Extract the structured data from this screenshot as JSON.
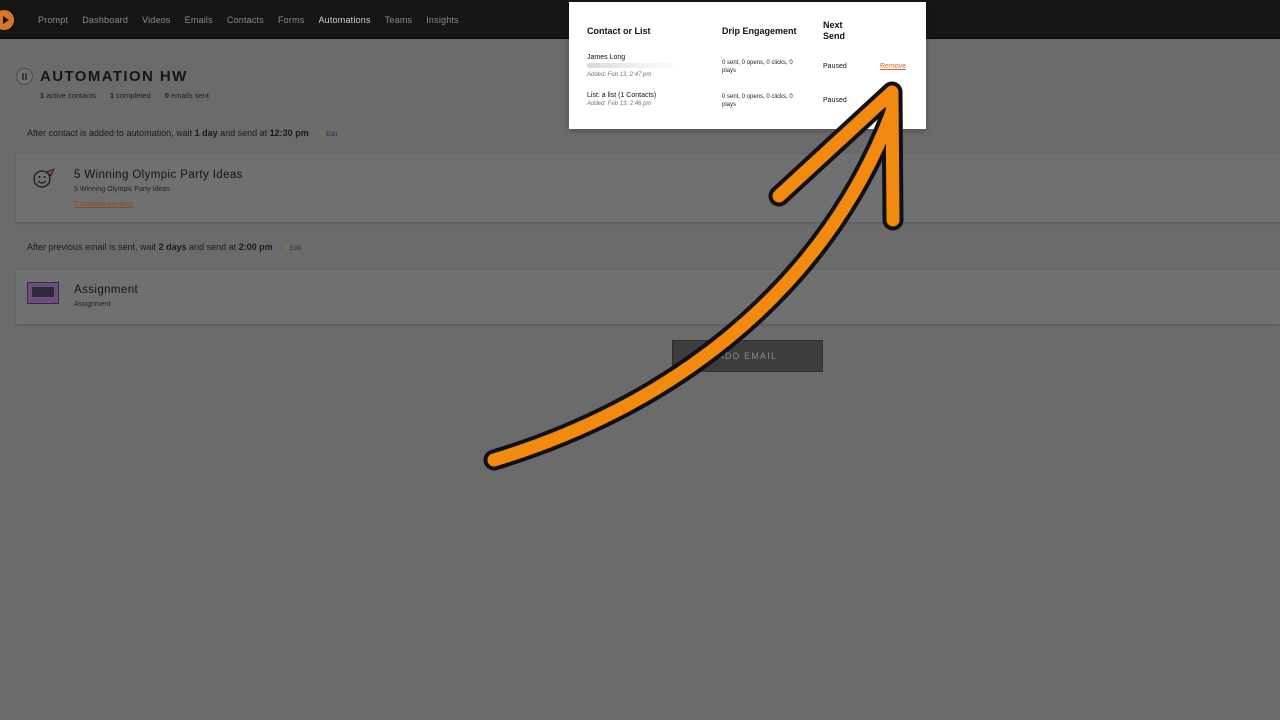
{
  "nav": {
    "items": [
      "Prompt",
      "Dashboard",
      "Videos",
      "Emails",
      "Contacts",
      "Forms",
      "Automations",
      "Teams",
      "Insights"
    ],
    "active_index": 6
  },
  "automation": {
    "title": "AUTOMATION HW",
    "status_icon": "pause-icon",
    "stats": {
      "active_count": "1",
      "active_label": "active contacts",
      "completed_count": "1",
      "completed_label": "completed",
      "sent_count": "0",
      "sent_label": "emails sent"
    }
  },
  "step1": {
    "prefix": "After contact is added to automation, wait ",
    "wait": "1 day",
    "middle": " and send at ",
    "time": "12:30 pm",
    "edit_label": "Edit"
  },
  "email1": {
    "title": "5 Winning Olympic Party Ideas",
    "subject": "5 Winning Olympic Party Ideas",
    "pending": "2 contacts pending"
  },
  "step2": {
    "prefix": "After previous email is sent, wait ",
    "wait": "2 days",
    "middle": " and send at ",
    "time": "2:00 pm",
    "edit_label": "Edit"
  },
  "email2": {
    "title": "Assignment",
    "subject": "Assignment"
  },
  "add_email_label": "ADD EMAIL",
  "panel": {
    "headers": {
      "contact": "Contact or List",
      "engagement": "Drip Engagement",
      "next_send": "Next Send"
    },
    "rows": [
      {
        "name": "James Long",
        "added": "Added: Feb 13, 2:47 pm",
        "engagement": "0 sent, 0 opens, 0 clicks, 0 plays",
        "next": "Paused",
        "remove": "Remove"
      },
      {
        "name": "List: a list (1 Contacts)",
        "added": "Added: Feb 13, 2:46 pm",
        "engagement": "0 sent, 0 opens, 0 clicks, 0 plays",
        "next": "Paused"
      }
    ]
  },
  "colors": {
    "accent_orange": "#f28a0f",
    "link_orange": "#d86a1e",
    "nav_bg": "#161616",
    "overlay_gray": "#6b6b6b"
  }
}
